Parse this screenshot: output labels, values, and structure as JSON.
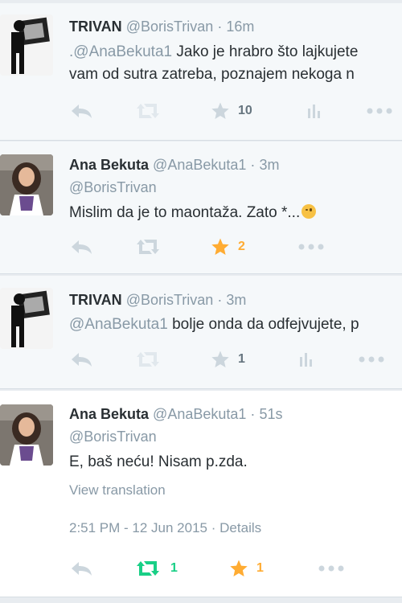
{
  "tweets": [
    {
      "fullname": "TRIVAN",
      "username": "@BorisTrivan",
      "time": "16m",
      "text_prefix": ".",
      "text_mention": "@AnaBekuta1",
      "text_rest": " Jako je hrabro što lajkujete",
      "text_line2": "vam od sutra zatreba, poznajem nekoga n",
      "favorites": "10",
      "favorited": false
    },
    {
      "fullname": "Ana Bekuta",
      "username": "@AnaBekuta1",
      "time": "3m",
      "reply_to": "@BorisTrivan",
      "text": "Mislim da je to maontaža. Zato *...",
      "favorites": "2",
      "favorited": true
    },
    {
      "fullname": "TRIVAN",
      "username": "@BorisTrivan",
      "time": "3m",
      "text_mention": "@AnaBekuta1",
      "text_rest": " bolje onda da odfejvujete, p",
      "favorites": "1",
      "favorited": false
    },
    {
      "fullname": "Ana Bekuta",
      "username": "@AnaBekuta1",
      "time": "51s",
      "reply_to": "@BorisTrivan",
      "text": "E, baš neću! Nisam p.zda.",
      "view_translation": "View translation",
      "timestamp": "2:51 PM - 12 Jun 2015",
      "details": "Details",
      "retweets": "1",
      "favorites": "1",
      "retweeted": true,
      "favorited": true
    }
  ],
  "separator": "·",
  "separator_dash": "-",
  "colors": {
    "muted": "#8899a6",
    "text": "#292f33",
    "favorite_active": "#ffac33",
    "retweet_active": "#19cf86",
    "icon_inactive": "#ccd6dd"
  },
  "icons": [
    "reply-icon",
    "retweet-icon",
    "favorite-icon",
    "stats-icon",
    "more-icon",
    "avatar-trivan",
    "avatar-ana"
  ]
}
